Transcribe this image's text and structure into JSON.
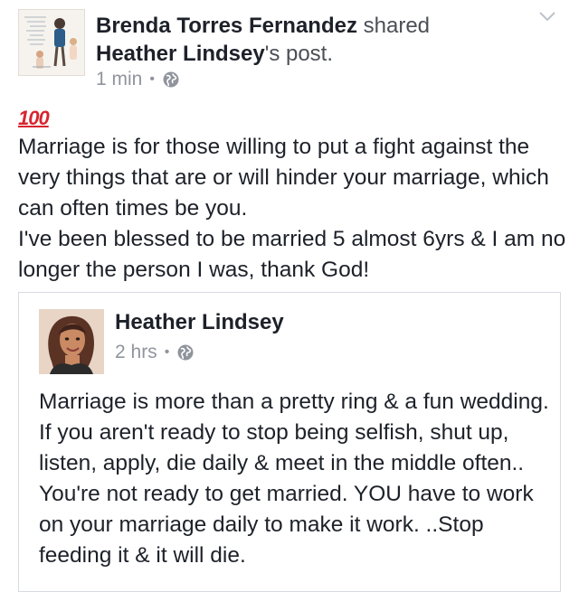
{
  "post": {
    "sharer_name": "Brenda Torres Fernandez",
    "shared_word": " shared",
    "original_author_name": "Heather Lindsey",
    "possessive_suffix": "'s post.",
    "time": "1 min",
    "privacy_icon": "globe-icon",
    "menu_icon": "chevron-down-icon",
    "reaction_emoji": "100",
    "reaction_emoji_color": "#d7262f",
    "body_lines": [
      "Marriage is for those willing to put a fight against the very things that are or will hinder your marriage, which can often times be you.",
      "I've been blessed to be married 5 almost 6yrs & I am no longer the person I was, thank God!"
    ]
  },
  "shared_post": {
    "author_name": "Heather Lindsey",
    "time": "2 hrs",
    "privacy_icon": "globe-icon",
    "body_text": "Marriage is more than a pretty ring & a fun wedding. If you aren't ready to stop being selfish, shut up, listen, apply, die daily & meet in the middle often.. You're not ready to get married. YOU have to work on your marriage daily to make it work. ..Stop feeding it & it will die."
  },
  "colors": {
    "text_primary": "#1d2129",
    "text_secondary": "#90949c",
    "border": "#d7dadf"
  }
}
